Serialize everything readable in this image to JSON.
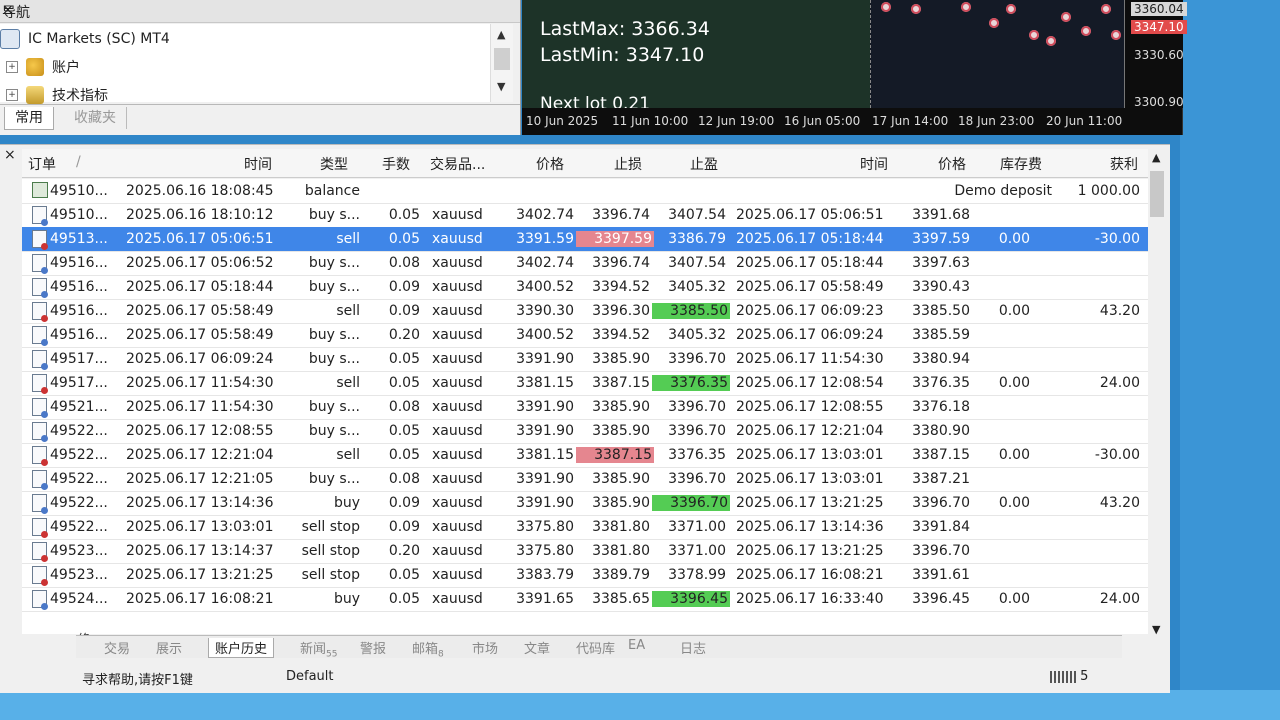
{
  "navigator": {
    "title": "导航",
    "close": "×",
    "tree": [
      {
        "label": "IC Markets (SC) MT4",
        "icon": "server-icon"
      },
      {
        "label": "账户",
        "icon": "account-icon"
      },
      {
        "label": "技术指标",
        "icon": "indicators-icon"
      }
    ],
    "tabs": [
      "常用",
      "收藏夹"
    ]
  },
  "chart": {
    "lastmax": "LastMax: 3366.34",
    "lastmin": "LastMin: 3347.10",
    "nextlot": "Next lot 0.21",
    "price_tags": [
      "3360.04",
      "3347.10",
      "3330.60",
      "3300.90"
    ],
    "dates": [
      "10 Jun 2025",
      "11 Jun 10:00",
      "12 Jun 19:00",
      "16 Jun 05:00",
      "17 Jun 14:00",
      "18 Jun 23:00",
      "20 Jun 11:00"
    ]
  },
  "terminal": {
    "close": "×",
    "headers": [
      "订单",
      "/",
      "时间",
      "类型",
      "手数",
      "交易品...",
      "价格",
      "止损",
      "止盈",
      "时间",
      "价格",
      "库存费",
      "获利"
    ],
    "rows": [
      {
        "order": "49510...",
        "open_time": "2025.06.16 18:08:45",
        "type": "balance",
        "lots": "",
        "symbol": "",
        "open_price": "",
        "sl": "",
        "tp": "",
        "close_time": "",
        "close_price": "",
        "swap": "",
        "profit": "1 000.00",
        "comment": "Demo deposit",
        "icon": "balance"
      },
      {
        "order": "49510...",
        "open_time": "2025.06.16 18:10:12",
        "type": "buy s...",
        "lots": "0.05",
        "symbol": "xauusd",
        "open_price": "3402.74",
        "sl": "3396.74",
        "tp": "3407.54",
        "close_time": "2025.06.17 05:06:51",
        "close_price": "3391.68",
        "swap": "",
        "profit": "",
        "icon": "doc"
      },
      {
        "order": "49513...",
        "open_time": "2025.06.17 05:06:51",
        "type": "sell",
        "lots": "0.05",
        "symbol": "xauusd",
        "open_price": "3391.59",
        "sl": "3397.59",
        "tp": "3386.79",
        "close_time": "2025.06.17 05:18:44",
        "close_price": "3397.59",
        "swap": "0.00",
        "profit": "-30.00",
        "icon": "doc-red",
        "selected": true,
        "sl_hl": "red"
      },
      {
        "order": "49516...",
        "open_time": "2025.06.17 05:06:52",
        "type": "buy s...",
        "lots": "0.08",
        "symbol": "xauusd",
        "open_price": "3402.74",
        "sl": "3396.74",
        "tp": "3407.54",
        "close_time": "2025.06.17 05:18:44",
        "close_price": "3397.63",
        "swap": "",
        "profit": "",
        "icon": "doc"
      },
      {
        "order": "49516...",
        "open_time": "2025.06.17 05:18:44",
        "type": "buy s...",
        "lots": "0.09",
        "symbol": "xauusd",
        "open_price": "3400.52",
        "sl": "3394.52",
        "tp": "3405.32",
        "close_time": "2025.06.17 05:58:49",
        "close_price": "3390.43",
        "swap": "",
        "profit": "",
        "icon": "doc"
      },
      {
        "order": "49516...",
        "open_time": "2025.06.17 05:58:49",
        "type": "sell",
        "lots": "0.09",
        "symbol": "xauusd",
        "open_price": "3390.30",
        "sl": "3396.30",
        "tp": "3385.50",
        "close_time": "2025.06.17 06:09:23",
        "close_price": "3385.50",
        "swap": "0.00",
        "profit": "43.20",
        "icon": "doc-red",
        "tp_hl": "green"
      },
      {
        "order": "49516...",
        "open_time": "2025.06.17 05:58:49",
        "type": "buy s...",
        "lots": "0.20",
        "symbol": "xauusd",
        "open_price": "3400.52",
        "sl": "3394.52",
        "tp": "3405.32",
        "close_time": "2025.06.17 06:09:24",
        "close_price": "3385.59",
        "swap": "",
        "profit": "",
        "icon": "doc"
      },
      {
        "order": "49517...",
        "open_time": "2025.06.17 06:09:24",
        "type": "buy s...",
        "lots": "0.05",
        "symbol": "xauusd",
        "open_price": "3391.90",
        "sl": "3385.90",
        "tp": "3396.70",
        "close_time": "2025.06.17 11:54:30",
        "close_price": "3380.94",
        "swap": "",
        "profit": "",
        "icon": "doc"
      },
      {
        "order": "49517...",
        "open_time": "2025.06.17 11:54:30",
        "type": "sell",
        "lots": "0.05",
        "symbol": "xauusd",
        "open_price": "3381.15",
        "sl": "3387.15",
        "tp": "3376.35",
        "close_time": "2025.06.17 12:08:54",
        "close_price": "3376.35",
        "swap": "0.00",
        "profit": "24.00",
        "icon": "doc-red",
        "tp_hl": "green"
      },
      {
        "order": "49521...",
        "open_time": "2025.06.17 11:54:30",
        "type": "buy s...",
        "lots": "0.08",
        "symbol": "xauusd",
        "open_price": "3391.90",
        "sl": "3385.90",
        "tp": "3396.70",
        "close_time": "2025.06.17 12:08:55",
        "close_price": "3376.18",
        "swap": "",
        "profit": "",
        "icon": "doc"
      },
      {
        "order": "49522...",
        "open_time": "2025.06.17 12:08:55",
        "type": "buy s...",
        "lots": "0.05",
        "symbol": "xauusd",
        "open_price": "3391.90",
        "sl": "3385.90",
        "tp": "3396.70",
        "close_time": "2025.06.17 12:21:04",
        "close_price": "3380.90",
        "swap": "",
        "profit": "",
        "icon": "doc"
      },
      {
        "order": "49522...",
        "open_time": "2025.06.17 12:21:04",
        "type": "sell",
        "lots": "0.05",
        "symbol": "xauusd",
        "open_price": "3381.15",
        "sl": "3387.15",
        "tp": "3376.35",
        "close_time": "2025.06.17 13:03:01",
        "close_price": "3387.15",
        "swap": "0.00",
        "profit": "-30.00",
        "icon": "doc-red",
        "sl_hl": "red"
      },
      {
        "order": "49522...",
        "open_time": "2025.06.17 12:21:05",
        "type": "buy s...",
        "lots": "0.08",
        "symbol": "xauusd",
        "open_price": "3391.90",
        "sl": "3385.90",
        "tp": "3396.70",
        "close_time": "2025.06.17 13:03:01",
        "close_price": "3387.21",
        "swap": "",
        "profit": "",
        "icon": "doc"
      },
      {
        "order": "49522...",
        "open_time": "2025.06.17 13:14:36",
        "type": "buy",
        "lots": "0.09",
        "symbol": "xauusd",
        "open_price": "3391.90",
        "sl": "3385.90",
        "tp": "3396.70",
        "close_time": "2025.06.17 13:21:25",
        "close_price": "3396.70",
        "swap": "0.00",
        "profit": "43.20",
        "icon": "doc",
        "tp_hl": "green"
      },
      {
        "order": "49522...",
        "open_time": "2025.06.17 13:03:01",
        "type": "sell stop",
        "lots": "0.09",
        "symbol": "xauusd",
        "open_price": "3375.80",
        "sl": "3381.80",
        "tp": "3371.00",
        "close_time": "2025.06.17 13:14:36",
        "close_price": "3391.84",
        "swap": "",
        "profit": "",
        "icon": "doc-red"
      },
      {
        "order": "49523...",
        "open_time": "2025.06.17 13:14:37",
        "type": "sell stop",
        "lots": "0.20",
        "symbol": "xauusd",
        "open_price": "3375.80",
        "sl": "3381.80",
        "tp": "3371.00",
        "close_time": "2025.06.17 13:21:25",
        "close_price": "3396.70",
        "swap": "",
        "profit": "",
        "icon": "doc-red"
      },
      {
        "order": "49523...",
        "open_time": "2025.06.17 13:21:25",
        "type": "sell stop",
        "lots": "0.05",
        "symbol": "xauusd",
        "open_price": "3383.79",
        "sl": "3389.79",
        "tp": "3378.99",
        "close_time": "2025.06.17 16:08:21",
        "close_price": "3391.61",
        "swap": "",
        "profit": "",
        "icon": "doc-red"
      },
      {
        "order": "49524...",
        "open_time": "2025.06.17 16:08:21",
        "type": "buy",
        "lots": "0.05",
        "symbol": "xauusd",
        "open_price": "3391.65",
        "sl": "3385.65",
        "tp": "3396.45",
        "close_time": "2025.06.17 16:33:40",
        "close_price": "3396.45",
        "swap": "0.00",
        "profit": "24.00",
        "icon": "doc",
        "tp_hl": "green"
      }
    ],
    "side_label": "终端",
    "tabs": [
      {
        "label": "交易",
        "active": false
      },
      {
        "label": "展示",
        "active": false
      },
      {
        "label": "账户历史",
        "active": true
      },
      {
        "label": "新闻",
        "badge": "55",
        "active": false
      },
      {
        "label": "警报",
        "active": false
      },
      {
        "label": "邮箱",
        "badge": "8",
        "active": false
      },
      {
        "label": "市场",
        "active": false
      },
      {
        "label": "文章",
        "active": false
      },
      {
        "label": "代码库",
        "active": false
      },
      {
        "label": "EA",
        "active": false
      },
      {
        "label": "日志",
        "active": false
      }
    ]
  },
  "statusbar": {
    "help": "寻求帮助,请按F1键",
    "profile": "Default",
    "conn": "5"
  },
  "colors": {
    "selection": "#3f86e8",
    "tp_hit": "#54cc54",
    "sl_hit": "#e5868f",
    "chart_bg": "#1d3328"
  }
}
